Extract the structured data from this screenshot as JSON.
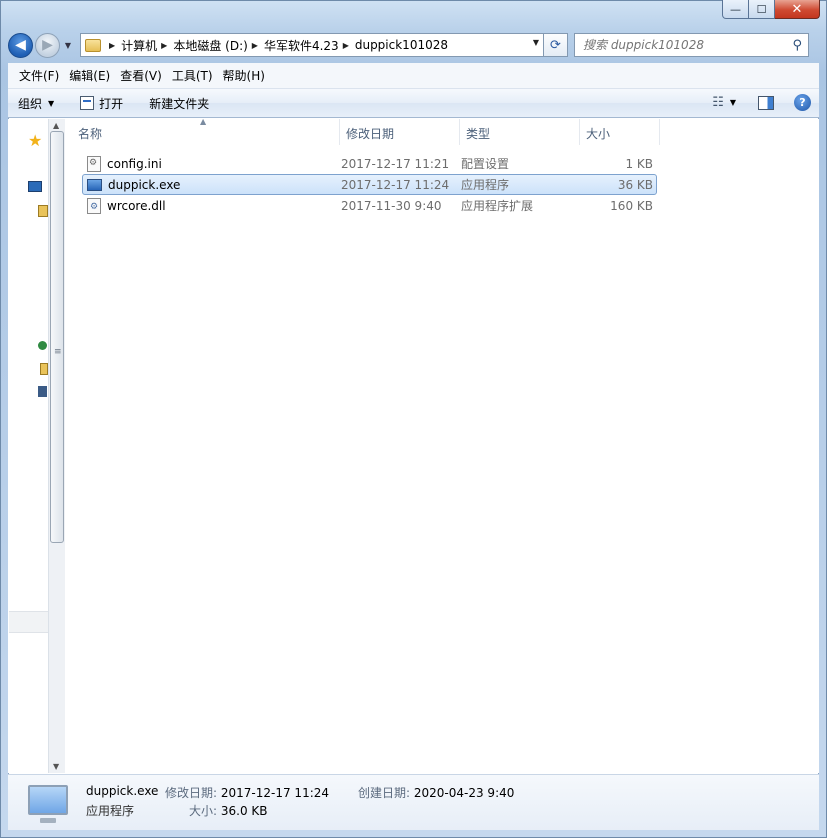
{
  "window": {
    "minimize_label": "—",
    "maximize_label": "☐",
    "close_label": "✕"
  },
  "nav": {
    "back_label": "◀",
    "forward_label": "▶",
    "breadcrumb": [
      "计算机",
      "本地磁盘 (D:)",
      "华军软件4.23",
      "duppick101028"
    ],
    "search_placeholder": "搜索 duppick101028"
  },
  "menubar": {
    "items": [
      "文件(F)",
      "编辑(E)",
      "查看(V)",
      "工具(T)",
      "帮助(H)"
    ]
  },
  "toolbar": {
    "organize_label": "组织",
    "open_label": "打开",
    "new_folder_label": "新建文件夹"
  },
  "columns": {
    "name": "名称",
    "date": "修改日期",
    "type": "类型",
    "size": "大小"
  },
  "files": [
    {
      "name": "config.ini",
      "date": "2017-12-17 11:21",
      "type": "配置设置",
      "size": "1 KB",
      "icon": "ini-file-icon",
      "selected": false
    },
    {
      "name": "duppick.exe",
      "date": "2017-12-17 11:24",
      "type": "应用程序",
      "size": "36 KB",
      "icon": "exe-file-icon",
      "selected": true
    },
    {
      "name": "wrcore.dll",
      "date": "2017-11-30 9:40",
      "type": "应用程序扩展",
      "size": "160 KB",
      "icon": "dll-file-icon",
      "selected": false
    }
  ],
  "details": {
    "name": "duppick.exe",
    "type": "应用程序",
    "modified_label": "修改日期:",
    "modified_value": "2017-12-17 11:24",
    "size_label": "大小:",
    "size_value": "36.0 KB",
    "created_label": "创建日期:",
    "created_value": "2020-04-23 9:40"
  },
  "colors": {
    "selection_bg": "#cce2fa",
    "selection_border": "#7da2ce",
    "header_text": "#4c607a"
  }
}
